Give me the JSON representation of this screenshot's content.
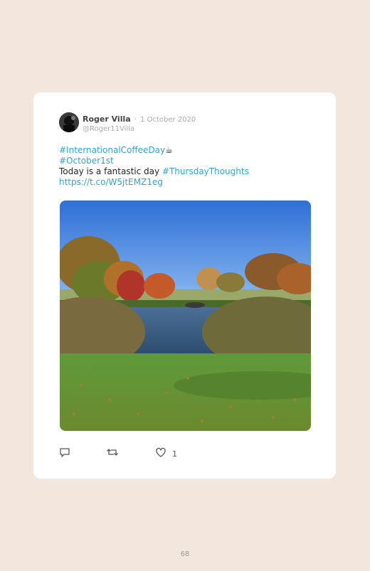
{
  "tweet": {
    "author_name": "Roger Villa",
    "separator": "·",
    "date": "1 October 2020",
    "handle": "@Roger11Villa",
    "lines": {
      "l1_tag": "#InternationalCoffeeDay",
      "l1_emoji": "☕",
      "l2_tag": "#October1st",
      "l3_text": "Today is a fantastic day ",
      "l3_tag": "#ThursdayThoughts",
      "l4_link": "https://t.co/W5jtEMZ1eg"
    },
    "likes": "1"
  },
  "icons": {
    "reply": "reply-icon",
    "retweet": "retweet-icon",
    "like": "heart-icon"
  },
  "page_number": "68",
  "colors": {
    "background": "#f3e6dc",
    "card": "#ffffff",
    "link": "#2fa3d6"
  }
}
